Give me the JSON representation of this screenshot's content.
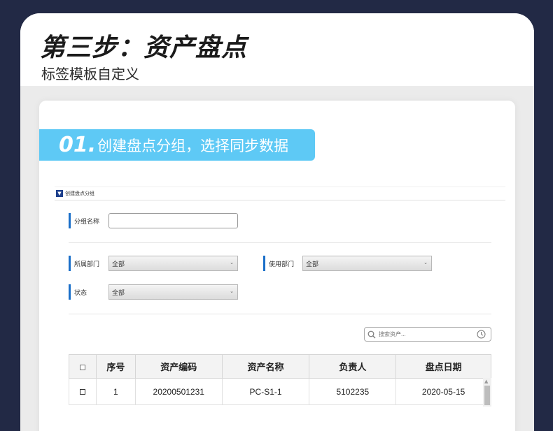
{
  "header": {
    "title": "第三步：资产盘点",
    "subtitle": "标签模板自定义"
  },
  "banner": {
    "number": "01.",
    "text": "创建盘点分组，选择同步数据"
  },
  "window": {
    "title": "创建盘点分组"
  },
  "form": {
    "group_name_label": "分组名称",
    "group_name_value": "",
    "dept_label": "所属部门",
    "dept_value": "全部",
    "use_dept_label": "使用部门",
    "use_dept_value": "全部",
    "status_label": "状态",
    "status_value": "全部"
  },
  "search": {
    "placeholder": "搜索资产..."
  },
  "table": {
    "headers": [
      "序号",
      "资产编码",
      "资产名称",
      "负责人",
      "盘点日期"
    ],
    "rows": [
      [
        "1",
        "20200501231",
        "PC-S1-1",
        "5102235",
        "2020-05-15"
      ]
    ]
  },
  "colors": {
    "background": "#222945",
    "banner": "#5ec9f5",
    "label_accent": "#1a6fc9"
  }
}
